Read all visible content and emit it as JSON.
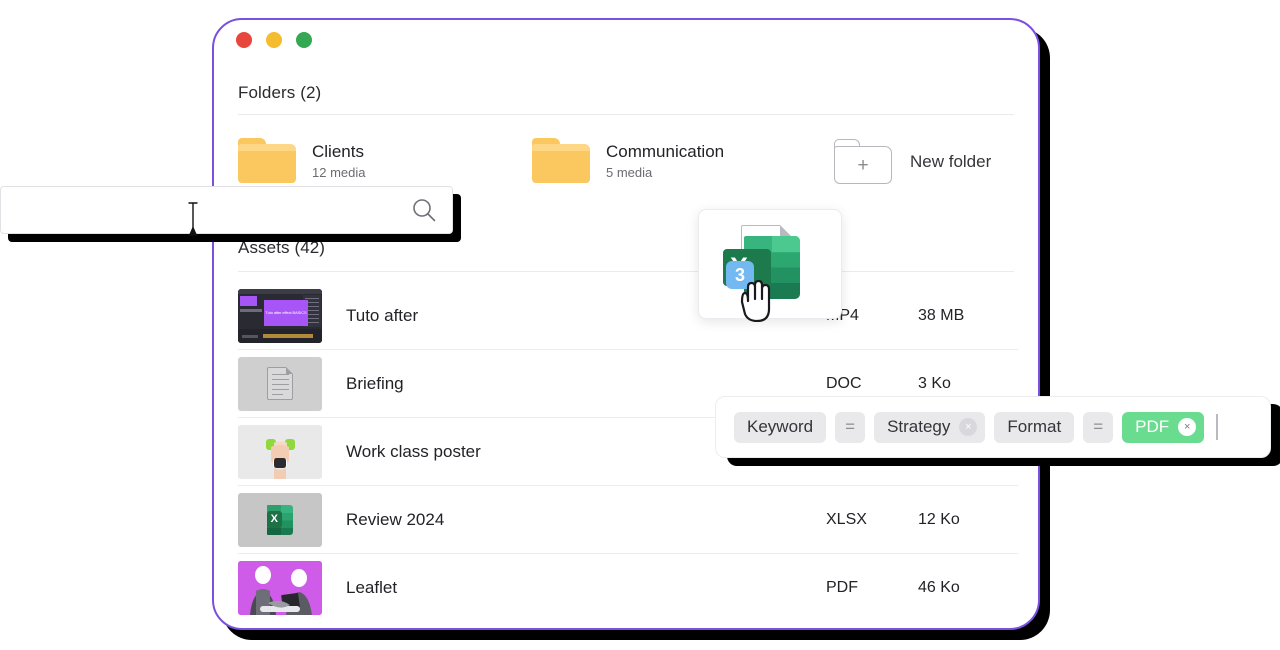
{
  "window": {
    "traffic_lights": [
      {
        "name": "close",
        "color": "#e8453c"
      },
      {
        "name": "minimize",
        "color": "#f5bc2f"
      },
      {
        "name": "maximize",
        "color": "#34a853"
      }
    ],
    "accent_border": "#7b4fe0"
  },
  "folders_section": {
    "title": "Folders (2)",
    "items": [
      {
        "name": "Clients",
        "count": "12 media"
      },
      {
        "name": "Communication",
        "count": "5 media"
      }
    ],
    "new_folder_label": "New folder",
    "new_folder_plus": "+"
  },
  "assets_section": {
    "title": "Assets (42)",
    "rows": [
      {
        "name": "Tuto after",
        "type": "MP4",
        "size": "38 MB",
        "thumb": "after-effects-screenshot-thumbnail",
        "thumb_caption": "Tuto after effect BASICS"
      },
      {
        "name": "Briefing",
        "type": "DOC",
        "size": "3 Ko",
        "thumb": "document-placeholder-thumbnail"
      },
      {
        "name": "Work class poster",
        "type": "",
        "size": "",
        "thumb": "hand-dumbbell-photo-thumbnail"
      },
      {
        "name": "Review 2024",
        "type": "XLSX",
        "size": "12 Ko",
        "thumb": "excel-file-thumbnail"
      },
      {
        "name": "Leaflet",
        "type": "PDF",
        "size": "46 Ko",
        "thumb": "handshake-photo-thumbnail"
      }
    ]
  },
  "search": {
    "value": "",
    "placeholder": "",
    "icon": "search-icon"
  },
  "drag_ghost": {
    "file_icon": "excel-file-icon",
    "x_letter": "X",
    "count": "3",
    "cursor": "grab-hand-cursor"
  },
  "filter_bar": {
    "chips": [
      {
        "kind": "field",
        "label": "Keyword"
      },
      {
        "kind": "operator",
        "label": "="
      },
      {
        "kind": "value",
        "label": "Strategy",
        "remove": "×",
        "highlight": false
      },
      {
        "kind": "field",
        "label": "Format"
      },
      {
        "kind": "operator",
        "label": "="
      },
      {
        "kind": "value",
        "label": "PDF",
        "remove": "×",
        "highlight": true
      }
    ],
    "highlight_color": "#69dc8f",
    "caret_visible": true
  }
}
